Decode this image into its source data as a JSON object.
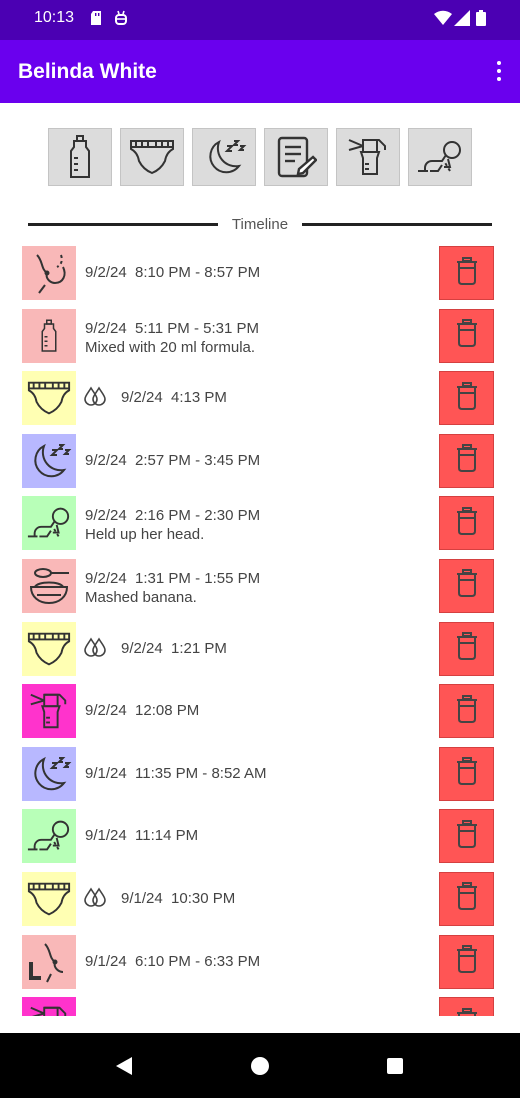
{
  "status_bar": {
    "time": "10:13"
  },
  "app_bar": {
    "title": "Belinda White"
  },
  "actions": [
    {
      "name": "bottle-button",
      "icon": "bottle-icon"
    },
    {
      "name": "diaper-button",
      "icon": "diaper-icon"
    },
    {
      "name": "sleep-button",
      "icon": "sleep-moon-icon"
    },
    {
      "name": "note-button",
      "icon": "note-pencil-icon"
    },
    {
      "name": "pump-button",
      "icon": "breast-pump-icon"
    },
    {
      "name": "tummy-time-button",
      "icon": "tummy-time-icon"
    }
  ],
  "timeline": {
    "label": "Timeline",
    "entries": [
      {
        "icon": "breastfeed-icon",
        "color": "#f9b8b8",
        "text": "9/2/24  8:10 PM - 8:57 PM",
        "note": ""
      },
      {
        "icon": "bottle-icon",
        "color": "#f9b8b8",
        "text": "9/2/24  5:11 PM - 5:31 PM",
        "note": "Mixed with 20 ml formula."
      },
      {
        "icon": "diaper-icon",
        "color": "#ffffb3",
        "text": "9/2/24  4:13 PM",
        "note": "",
        "wet": true
      },
      {
        "icon": "sleep-moon-icon",
        "color": "#b8b8ff",
        "text": "9/2/24  2:57 PM - 3:45 PM",
        "note": ""
      },
      {
        "icon": "tummy-time-icon",
        "color": "#b8ffb8",
        "text": "9/2/24  2:16 PM - 2:30 PM",
        "note": "Held up her head."
      },
      {
        "icon": "solid-food-icon",
        "color": "#f9b8b8",
        "text": "9/2/24  1:31 PM - 1:55 PM",
        "note": "Mashed banana."
      },
      {
        "icon": "diaper-icon",
        "color": "#ffffb3",
        "text": "9/2/24  1:21 PM",
        "note": "",
        "wet": true
      },
      {
        "icon": "breast-pump-icon",
        "color": "#ff33cc",
        "text": "9/2/24  12:08 PM",
        "note": ""
      },
      {
        "icon": "sleep-moon-icon",
        "color": "#b8b8ff",
        "text": "9/1/24  11:35 PM - 8:52 AM",
        "note": ""
      },
      {
        "icon": "tummy-time-icon",
        "color": "#b8ffb8",
        "text": "9/1/24  11:14 PM",
        "note": ""
      },
      {
        "icon": "diaper-icon",
        "color": "#ffffb3",
        "text": "9/1/24  10:30 PM",
        "note": "",
        "wet": true
      },
      {
        "icon": "breastfeed-left-icon",
        "color": "#f9b8b8",
        "text": "9/1/24  6:10 PM - 6:33 PM",
        "note": ""
      },
      {
        "icon": "breast-pump-icon",
        "color": "#ff33cc",
        "text": "",
        "note": ""
      }
    ]
  }
}
